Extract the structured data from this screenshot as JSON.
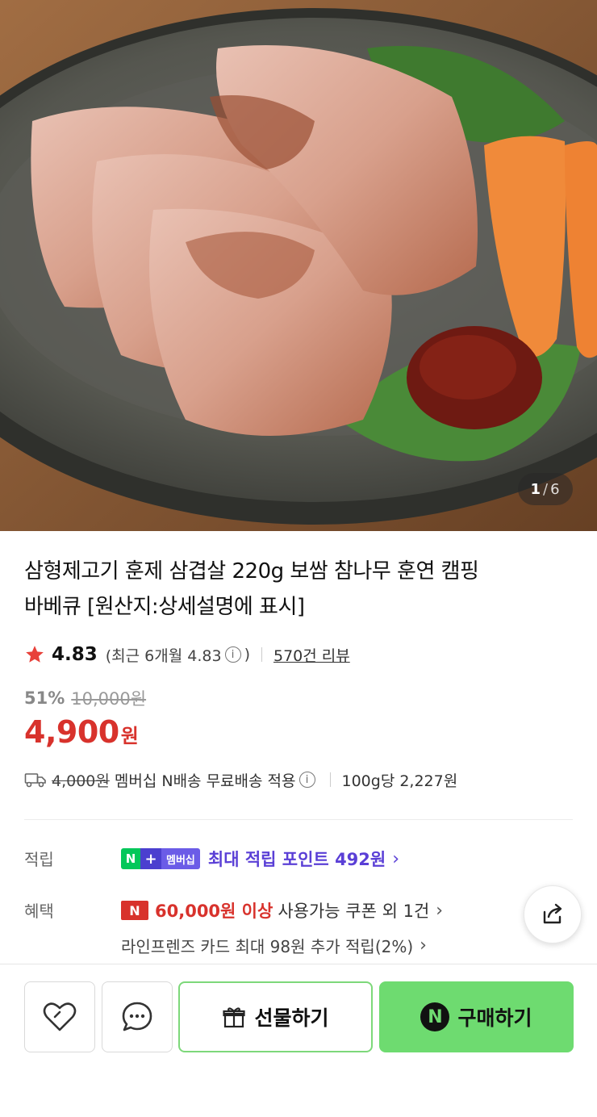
{
  "hero": {
    "image_desc_icon": "product-photo",
    "pager_current": "1",
    "pager_separator": "/",
    "pager_total": "6"
  },
  "product": {
    "title_line1": "삼형제고기 훈제 삼겹살 220g 보쌈 참나무 훈연 캠핑",
    "title_line2": "바베큐 [원산지:상세설명에 표시]",
    "rating": "4.83",
    "recent_prefix": "(최근 6개월 4.83",
    "recent_suffix": ")",
    "review_count": "570건 리뷰",
    "discount_rate": "51%",
    "original_price": "10,000원",
    "price": "4,900",
    "price_unit": "원",
    "shipping_original": "4,000원",
    "shipping_text": "멤버십 N배송 무료배송 적용",
    "unit_price": "100g당 2,227원"
  },
  "points": {
    "label": "적립",
    "badge_n": "N",
    "badge_plus": "+",
    "badge_member": "멤버십",
    "text": "최대 적립 포인트 492원"
  },
  "benefits": {
    "label": "혜택",
    "badge_n": "N",
    "coupon_amount": "60,000원 이상",
    "coupon_text": "사용가능 쿠폰 외 1건",
    "card_text": "라인프렌즈 카드 최대 98원 추가 적립(2%)"
  },
  "actions": {
    "gift_label": "선물하기",
    "buy_label": "구매하기",
    "buy_badge": "N"
  },
  "colors": {
    "price_red": "#d8322c",
    "point_purple": "#5a3fd6",
    "buy_green": "#6edb70"
  }
}
